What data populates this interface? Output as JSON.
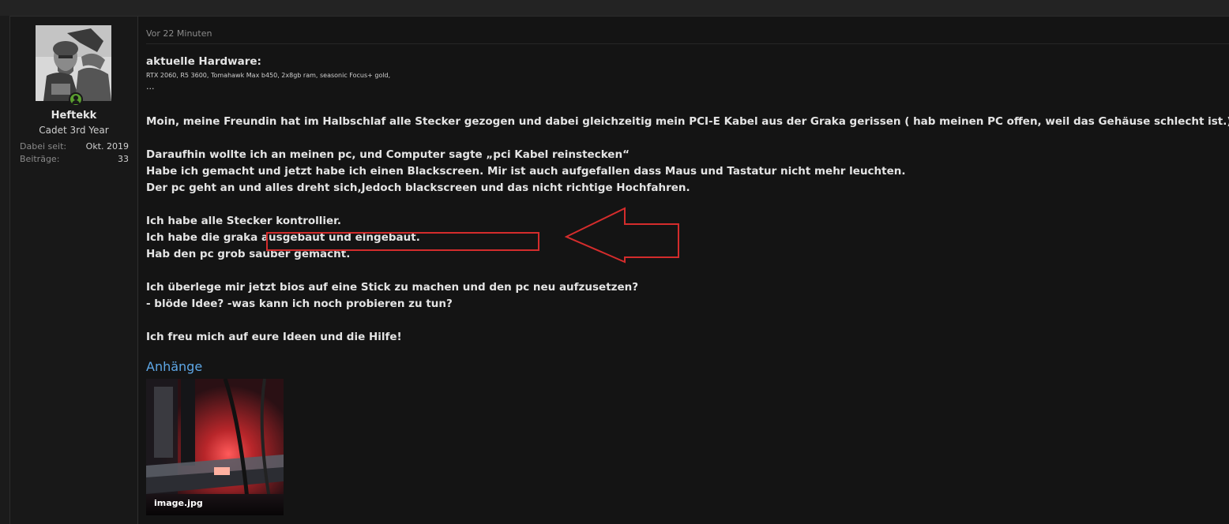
{
  "post": {
    "time": "Vor 22 Minuten",
    "author": {
      "name": "Heftekk",
      "title": "Cadet 3rd Year",
      "stats": [
        {
          "label": "Dabei seit:",
          "value": "Okt. 2019"
        },
        {
          "label": "Beiträge:",
          "value": "33"
        }
      ]
    },
    "signature_heading": "aktuelle Hardware:",
    "signature_specs": "RTX 2060, R5 3600, Tomahawk Max b450, 2x8gb ram, seasonic Focus+ gold,",
    "signature_ellipsis": "...",
    "paragraph1": "Moin, meine Freundin hat im Halbschlaf alle Stecker gezogen und dabei gleichzeitig mein PCI-E Kabel aus der Graka gerissen ( hab meinen PC offen, weil das Gehäuse schlecht ist.)",
    "paragraph2": [
      "Daraufhin wollte ich an meinen pc, und Computer sagte „pci Kabel reinstecken“",
      "Habe ich gemacht und jetzt habe ich einen Blackscreen. Mir ist auch aufgefallen dass Maus und Tastatur nicht mehr leuchten.",
      "Der pc geht an und alles dreht sich,Jedoch blackscreen und das nicht richtige Hochfahren."
    ],
    "paragraph3": [
      "Ich habe alle Stecker kontrollier.",
      "Ich habe die graka ausgebaut und eingebaut.",
      "Hab den pc grob sauber gemacht."
    ],
    "paragraph4": [
      "Ich überlege mir jetzt bios auf eine Stick zu machen und den pc neu aufzusetzen?",
      "- blöde Idee? -was kann ich noch probieren zu tun?"
    ],
    "paragraph5": "Ich freu mich auf eure Ideen und die Hilfe!",
    "attachments_title": "Anhänge",
    "attachment": {
      "filename": "image.jpg"
    }
  },
  "colors": {
    "background": "#141414",
    "text": "#e4e4e4",
    "link": "#5ea7e6",
    "annotation_red": "#d42c2c",
    "online_green": "#5a9e2f"
  },
  "icons": {
    "online_status": "user-online-icon",
    "annotation": "arrow-left-outline"
  }
}
